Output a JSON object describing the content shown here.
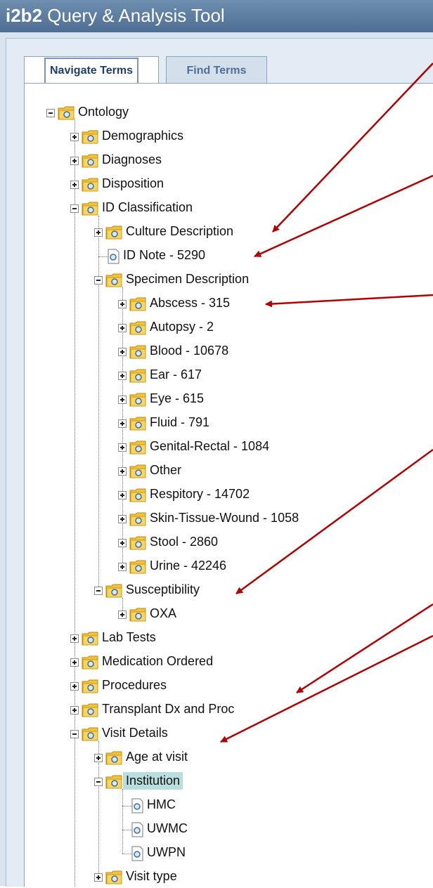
{
  "app": {
    "brand": "i2b2",
    "title": "Query & Analysis Tool"
  },
  "tabs": [
    {
      "label": "Navigate Terms",
      "active": true
    },
    {
      "label": "Find Terms",
      "active": false
    }
  ],
  "tree": {
    "root": "Ontology",
    "items": [
      {
        "label": "Demographics",
        "type": "folder",
        "state": "collapsed"
      },
      {
        "label": "Diagnoses",
        "type": "folder",
        "state": "collapsed"
      },
      {
        "label": "Disposition",
        "type": "folder",
        "state": "collapsed"
      },
      {
        "label": "ID Classification",
        "type": "folder",
        "state": "expanded"
      },
      {
        "label": "Culture Description",
        "type": "folder",
        "state": "collapsed"
      },
      {
        "label": "ID Note - 5290",
        "type": "leaf"
      },
      {
        "label": "Specimen Description",
        "type": "folder",
        "state": "expanded"
      },
      {
        "label": "Abscess - 315",
        "type": "folder",
        "state": "collapsed"
      },
      {
        "label": "Autopsy - 2",
        "type": "folder",
        "state": "collapsed"
      },
      {
        "label": "Blood - 10678",
        "type": "folder",
        "state": "collapsed"
      },
      {
        "label": "Ear - 617",
        "type": "folder",
        "state": "collapsed"
      },
      {
        "label": "Eye - 615",
        "type": "folder",
        "state": "collapsed"
      },
      {
        "label": "Fluid - 791",
        "type": "folder",
        "state": "collapsed"
      },
      {
        "label": "Genital-Rectal - 1084",
        "type": "folder",
        "state": "collapsed"
      },
      {
        "label": "Other",
        "type": "folder",
        "state": "collapsed"
      },
      {
        "label": "Respitory - 14702",
        "type": "folder",
        "state": "collapsed"
      },
      {
        "label": "Skin-Tissue-Wound - 1058",
        "type": "folder",
        "state": "collapsed"
      },
      {
        "label": "Stool - 2860",
        "type": "folder",
        "state": "collapsed"
      },
      {
        "label": "Urine - 42246",
        "type": "folder",
        "state": "collapsed"
      },
      {
        "label": "Susceptibility",
        "type": "folder",
        "state": "expanded"
      },
      {
        "label": "OXA",
        "type": "folder",
        "state": "collapsed"
      },
      {
        "label": "Lab Tests",
        "type": "folder",
        "state": "collapsed"
      },
      {
        "label": "Medication Ordered",
        "type": "folder",
        "state": "collapsed"
      },
      {
        "label": "Procedures",
        "type": "folder",
        "state": "collapsed"
      },
      {
        "label": "Transplant Dx and Proc",
        "type": "folder",
        "state": "collapsed"
      },
      {
        "label": "Visit Details",
        "type": "folder",
        "state": "expanded"
      },
      {
        "label": "Age at visit",
        "type": "folder",
        "state": "collapsed"
      },
      {
        "label": "Institution",
        "type": "folder",
        "state": "expanded",
        "selected": true
      },
      {
        "label": "HMC",
        "type": "leaf"
      },
      {
        "label": "UWMC",
        "type": "leaf"
      },
      {
        "label": "UWPN",
        "type": "leaf"
      },
      {
        "label": "Visit type",
        "type": "folder",
        "state": "collapsed"
      }
    ]
  },
  "colors": {
    "annotation_arrow": "#b30000",
    "selection": "#b8dede",
    "titlebar": "#5b7ca3"
  }
}
